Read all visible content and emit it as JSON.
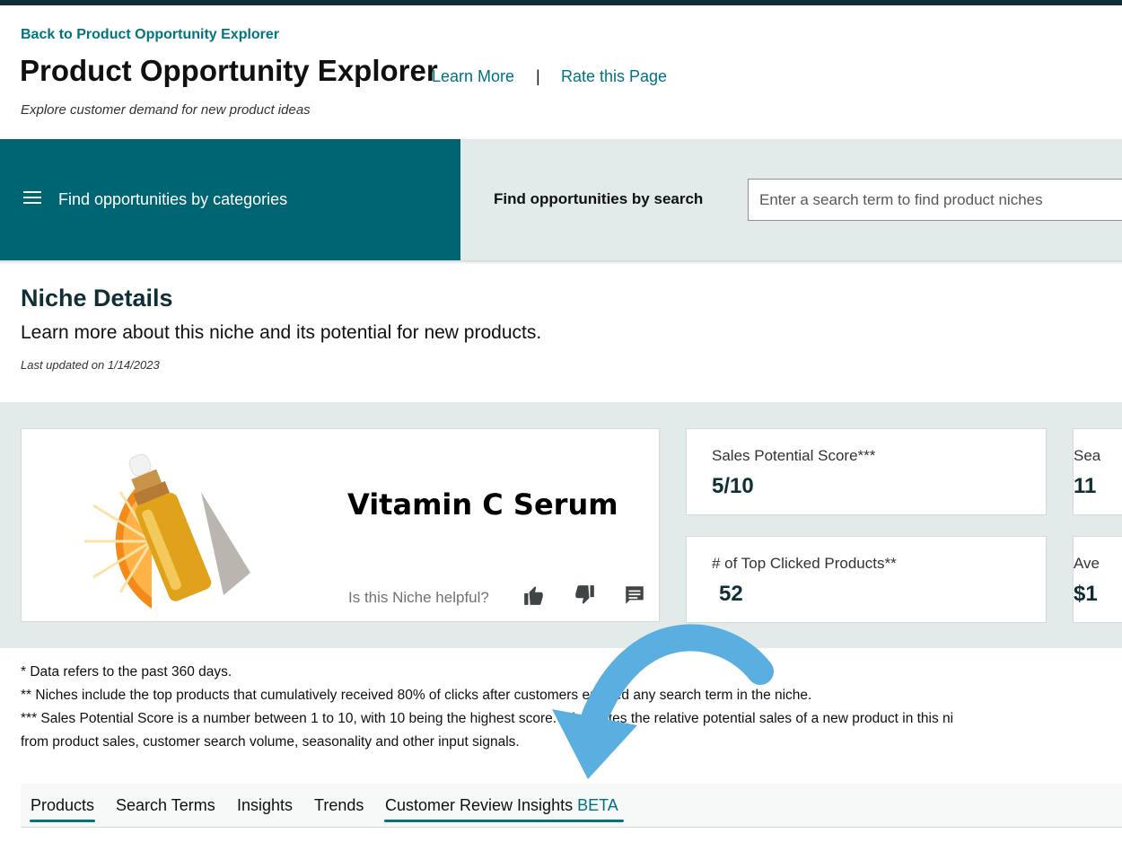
{
  "header": {
    "back_link": "Back to Product Opportunity Explorer",
    "title": "Product Opportunity Explorer",
    "learn_more": "Learn More",
    "separator": "|",
    "rate_page": "Rate this Page",
    "subtitle": "Explore customer demand for new product ideas"
  },
  "category_panel": {
    "label": "Find opportunities by categories",
    "icon": "hamburger-menu-icon"
  },
  "search_panel": {
    "label": "Find opportunities by search",
    "placeholder": "Enter a search term to find product niches",
    "value": ""
  },
  "niche": {
    "heading": "Niche Details",
    "description": "Learn more about this niche and its potential for new products.",
    "last_updated": "Last updated on 1/14/2023",
    "name": "Vitamin C Serum",
    "helpful_question": "Is this Niche helpful?",
    "feedback_icons": [
      "thumbs-up-icon",
      "thumbs-down-icon",
      "comment-icon"
    ]
  },
  "metrics": [
    {
      "label": "Sales Potential Score***",
      "value": "5/10"
    },
    {
      "label": "# of Top Clicked Products**",
      "value": "52"
    },
    {
      "label": "Sea",
      "value": "11"
    },
    {
      "label": "Ave",
      "value": "$1"
    }
  ],
  "footnotes": [
    "* Data refers to the past 360 days.",
    "** Niches include the top products that cumulatively received 80% of clicks after customers entered any search term in the niche.",
    "*** Sales Potential Score is a number between 1 to 10, with 10 being the highest score. It indicates the relative potential sales of a new product in this ni",
    "from product sales, customer search volume, seasonality and other input signals."
  ],
  "tabs": [
    {
      "label": "Products",
      "active": true
    },
    {
      "label": "Search Terms",
      "active": false
    },
    {
      "label": "Insights",
      "active": false
    },
    {
      "label": "Trends",
      "active": false
    },
    {
      "label": "Customer Review Insights",
      "badge": "BETA",
      "active": false
    }
  ],
  "colors": {
    "teal_panel": "#006573",
    "link": "#007185",
    "band": "#e3eaea",
    "arrow": "#5aaee0"
  }
}
